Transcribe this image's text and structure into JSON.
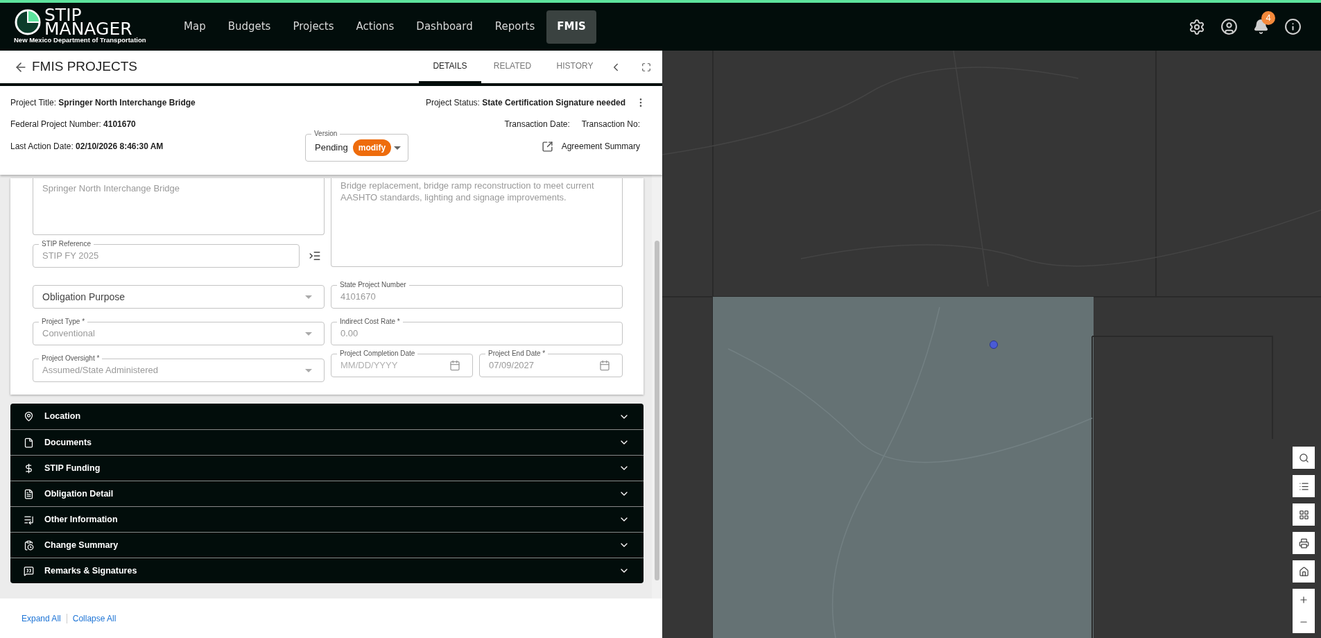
{
  "brand": {
    "title_line_1": "STIP",
    "title_line_2": "MANAGER",
    "subtitle": "New Mexico Department of Transportation"
  },
  "nav": [
    {
      "label": "Map",
      "selected": false
    },
    {
      "label": "Budgets",
      "selected": false
    },
    {
      "label": "Projects",
      "selected": false
    },
    {
      "label": "Actions",
      "selected": false
    },
    {
      "label": "Dashboard",
      "selected": false
    },
    {
      "label": "Reports",
      "selected": false
    },
    {
      "label": "FMIS",
      "selected": true
    }
  ],
  "notifications": {
    "count": "4"
  },
  "panel": {
    "title": "FMIS PROJECTS",
    "tabs": [
      {
        "label": "DETAILS",
        "selected": true
      },
      {
        "label": "RELATED",
        "selected": false
      },
      {
        "label": "HISTORY",
        "selected": false
      }
    ]
  },
  "summary": {
    "project_title": "Project Title: **Springer North Interchange Bridge**",
    "project_status": "Project Status: **State Certification Signature needed**",
    "federal_project_number": "Federal Project Number: **4101670**",
    "transaction_date": "Transaction Date:",
    "transaction_no": "Transaction No:",
    "last_action_date": "Last Action Date: **02/10/2026 8:46:30 AM**",
    "version": {
      "label": "Version",
      "value": "Pending",
      "chip": "modify"
    },
    "agreement_summary": "Agreement Summary"
  },
  "form": {
    "title_field": {
      "value": "Springer North Interchange Bridge"
    },
    "description_field": {
      "value": "Bridge replacement, bridge ramp reconstruction to meet current AASHTO standards, lighting and signage improvements."
    },
    "stip_reference": {
      "label": "STIP Reference",
      "value": "STIP FY 2025"
    },
    "obligation_purpose": {
      "placeholder": "Obligation Purpose"
    },
    "state_project_number": {
      "label": "State Project Number",
      "value": "4101670"
    },
    "project_type": {
      "label": "Project Type *",
      "value": "Conventional"
    },
    "indirect_cost_rate": {
      "label": "Indirect Cost Rate *",
      "value": "0.00"
    },
    "project_oversight": {
      "label": "Project Oversight *",
      "value": "Assumed/State Administered"
    },
    "completion_date": {
      "label": "Project Completion Date",
      "placeholder": "MM/DD/YYYY"
    },
    "end_date": {
      "label": "Project End Date *",
      "value": "07/09/2027"
    }
  },
  "sections": [
    {
      "label": "Location",
      "expanded": false
    },
    {
      "label": "Documents",
      "expanded": false
    },
    {
      "label": "STIP Funding",
      "expanded": false
    },
    {
      "label": "Obligation Detail",
      "expanded": false
    },
    {
      "label": "Other Information",
      "expanded": false
    },
    {
      "label": "Change Summary",
      "expanded": false
    },
    {
      "label": "Remarks & Signatures",
      "expanded": false
    }
  ],
  "footer": {
    "expand_all": "Expand All",
    "collapse_all": "Collapse All"
  }
}
